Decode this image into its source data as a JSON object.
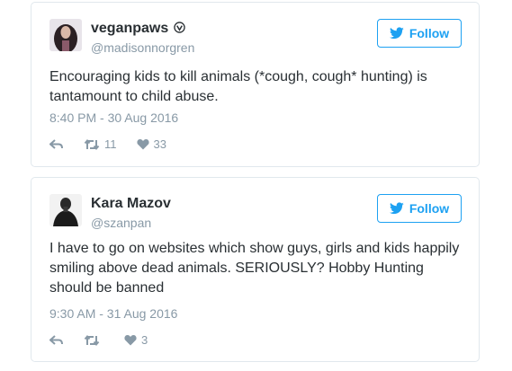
{
  "colors": {
    "accent": "#1da1f2",
    "meta": "#8899a6",
    "text": "#292f33",
    "border": "#e1e8ed"
  },
  "tweets": [
    {
      "display_name": "veganpaws",
      "verified_icon": "verified-badge-icon",
      "handle": "@madisonnorgren",
      "follow_label": "Follow",
      "text": "Encouraging kids to kill animals (*cough, cough* hunting) is tantamount to child abuse.",
      "timestamp": "8:40 PM - 30 Aug 2016",
      "retweets": "11",
      "likes": "33"
    },
    {
      "display_name": "Kara Mazov",
      "handle": "@szanpan",
      "follow_label": "Follow",
      "text": "I have to go on websites which show guys, girls and kids happily smiling above dead animals. SERIOUSLY? Hobby Hunting should be banned",
      "timestamp": "9:30 AM - 31 Aug 2016",
      "retweets": "",
      "likes": "3"
    }
  ]
}
